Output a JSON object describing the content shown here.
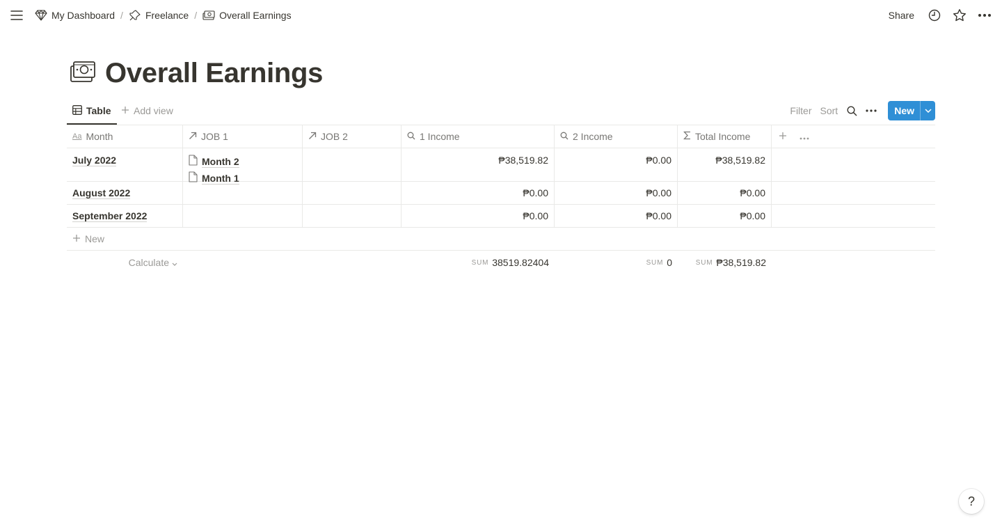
{
  "breadcrumbs": [
    {
      "label": "My Dashboard",
      "icon": "diamond-icon"
    },
    {
      "label": "Freelance",
      "icon": "pushpin-icon"
    },
    {
      "label": "Overall Earnings",
      "icon": "money-icon"
    }
  ],
  "separator": "/",
  "topbar": {
    "share_label": "Share"
  },
  "page": {
    "title": "Overall Earnings"
  },
  "views": {
    "active_tab": "Table",
    "add_view": "Add view"
  },
  "actions": {
    "filter": "Filter",
    "sort": "Sort",
    "new_button": "New"
  },
  "table": {
    "columns": [
      {
        "label": "Month",
        "icon": "text-property-icon"
      },
      {
        "label": "JOB 1",
        "icon": "relation-arrow-icon"
      },
      {
        "label": "JOB 2",
        "icon": "relation-arrow-icon"
      },
      {
        "label": "1 Income",
        "icon": "rollup-search-icon"
      },
      {
        "label": "2 Income",
        "icon": "rollup-search-icon"
      },
      {
        "label": "Total Income",
        "icon": "formula-sigma-icon"
      }
    ],
    "rows": [
      {
        "month": "July 2022",
        "job1": [
          "Month 2",
          "Month 1"
        ],
        "job2": [],
        "income1": "₱38,519.82",
        "income2": "₱0.00",
        "total": "₱38,519.82"
      },
      {
        "month": "August 2022",
        "job1": [],
        "job2": [],
        "income1": "₱0.00",
        "income2": "₱0.00",
        "total": "₱0.00"
      },
      {
        "month": "September 2022",
        "job1": [],
        "job2": [],
        "income1": "₱0.00",
        "income2": "₱0.00",
        "total": "₱0.00"
      }
    ],
    "new_row_label": "New",
    "calculate_label": "Calculate",
    "sums": {
      "label": "SUM",
      "income1": "38519.82404",
      "income2": "0",
      "total": "₱38,519.82"
    }
  },
  "help": {
    "label": "?"
  },
  "colors": {
    "accent": "#2f8fd6",
    "text": "#37352f",
    "muted": "#9b9a97",
    "border": "#e9e9e7"
  }
}
